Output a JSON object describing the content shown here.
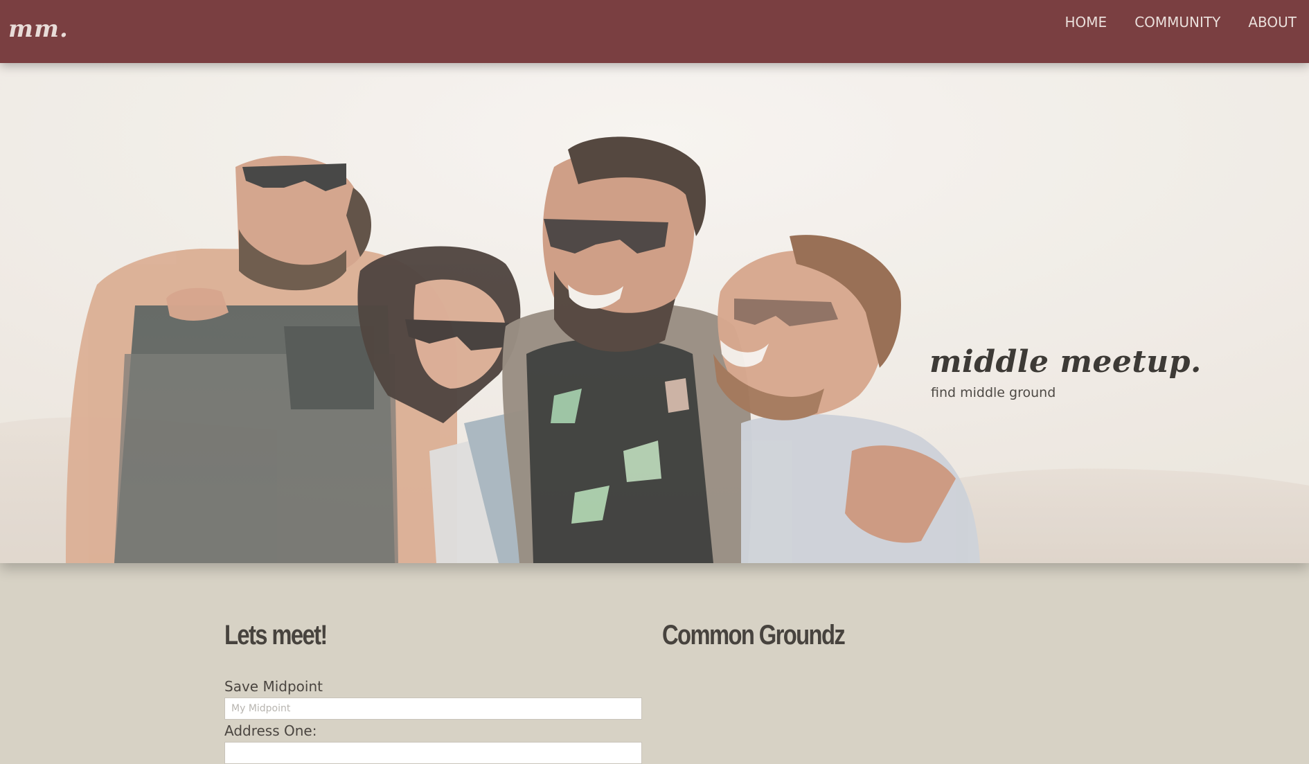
{
  "navbar": {
    "brand": "mm.",
    "links": [
      "HOME",
      "COMMUNITY",
      "ABOUT"
    ]
  },
  "hero": {
    "title": "middle meetup.",
    "subtitle": "find middle ground"
  },
  "meet_section": {
    "heading": "Lets meet!",
    "fields": [
      {
        "label": "Save Midpoint",
        "placeholder": "My Midpoint",
        "value": ""
      },
      {
        "label": "Address One:",
        "placeholder": "",
        "value": ""
      }
    ]
  },
  "groundz_section": {
    "heading": "Common Groundz"
  },
  "colors": {
    "navbar": "#7a3f41",
    "page_background": "#d7d2c5",
    "text_dark": "#47433e"
  }
}
